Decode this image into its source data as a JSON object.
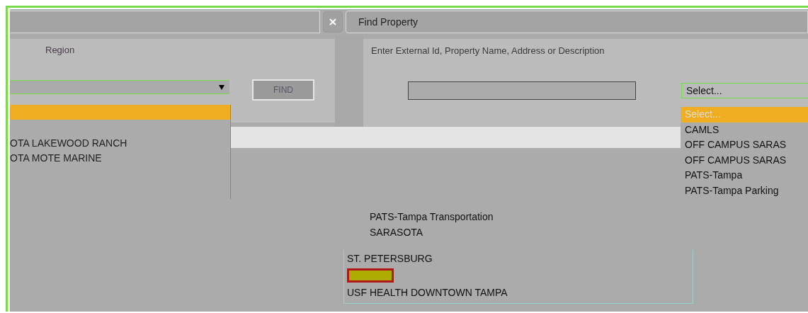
{
  "region_panel": {
    "label": "Region",
    "find_button": "FIND",
    "region_options": [
      {
        "selected": true
      },
      {
        "label": "OTA LAKEWOOD RANCH",
        "selected": false
      },
      {
        "label": "OTA MOTE MARINE",
        "selected": false
      }
    ]
  },
  "find_property": {
    "title": "Find Property",
    "search_label": "Enter External Id, Property Name, Address or Description",
    "select": {
      "value": "Select...",
      "options": [
        {
          "label": "Select...",
          "selected": true
        },
        {
          "label": "CAMLS",
          "selected": false
        },
        {
          "label": "OFF CAMPUS SARAS",
          "selected": false
        },
        {
          "label": "OFF CAMPUS SARAS",
          "selected": false
        },
        {
          "label": "PATS-Tampa",
          "selected": false
        },
        {
          "label": "PATS-Tampa Parking",
          "selected": false
        }
      ]
    }
  },
  "lower_list": {
    "upper_items": [
      {
        "label": "PATS-Tampa Transportation"
      },
      {
        "label": "SARASOTA"
      }
    ],
    "items": [
      {
        "label": "ST. PETERSBURG",
        "selected": false
      },
      {
        "selected": true
      },
      {
        "label": "USF HEALTH DOWNTOWN TAMPA",
        "selected": false
      }
    ]
  }
}
